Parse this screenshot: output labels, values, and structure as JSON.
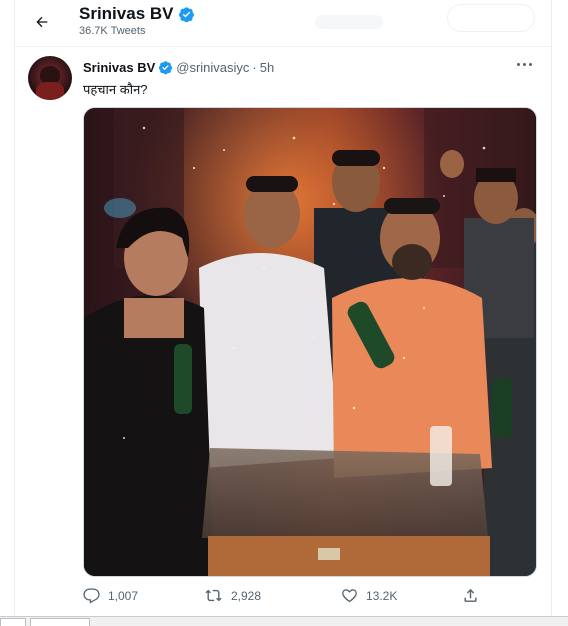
{
  "header": {
    "back_icon": "arrow-left-icon",
    "name": "Srinivas BV",
    "tweet_count": "36.7K Tweets",
    "verified_icon": "verified-badge-icon"
  },
  "tweet": {
    "author_name": "Srinivas BV",
    "handle": "@srinivasiyc",
    "separator": "·",
    "time": "5h",
    "text": "पहचान कौन?",
    "more_icon": "more-horizontal-icon",
    "image_icon": "photo",
    "actions": {
      "reply_count": "1,007",
      "retweet_count": "2,928",
      "like_count": "13.2K",
      "reply_icon": "reply-icon",
      "retweet_icon": "retweet-icon",
      "like_icon": "heart-icon",
      "share_icon": "share-icon"
    }
  },
  "colors": {
    "verified": "#1d9bf0",
    "muted_text": "#536471",
    "primary_text": "#0f1419",
    "border": "#e6ecf0"
  }
}
